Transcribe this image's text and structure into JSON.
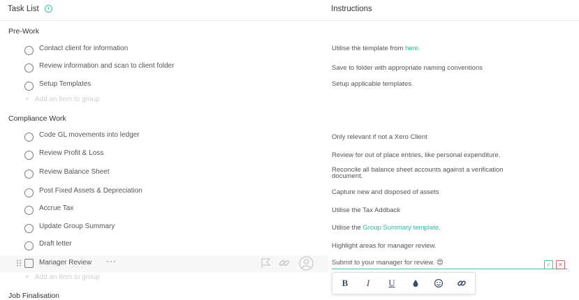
{
  "header": {
    "task_list_label": "Task List",
    "add_icon": "plus-circle-icon",
    "instructions_label": "Instructions"
  },
  "sections": [
    {
      "title": "Pre-Work"
    },
    {
      "title": "Compliance Work"
    },
    {
      "title": "Job Finalisation"
    }
  ],
  "prework": [
    {
      "label": "Contact client for information",
      "instr_before": "Utilise the template from ",
      "instr_link": "here.",
      "instr_after": ""
    },
    {
      "label": "Review information and scan to client folder",
      "instr_before": "Save to folder with appropriate naming conventions",
      "instr_link": "",
      "instr_after": ""
    },
    {
      "label": "Setup Templates",
      "instr_before": "Setup applicable templates",
      "instr_link": "",
      "instr_after": ""
    }
  ],
  "compliance": [
    {
      "label": "Code GL movements into ledger",
      "instr_before": "Only relevant if not a Xero Client",
      "instr_link": "",
      "instr_after": ""
    },
    {
      "label": "Review Profit & Loss",
      "instr_before": "Review for out of place entries, like personal expenditure.",
      "instr_link": "",
      "instr_after": ""
    },
    {
      "label": "Review Balance Sheet",
      "instr_before": "Reconcile all balance sheet accounts against a verification document.",
      "instr_link": "",
      "instr_after": ""
    },
    {
      "label": "Post Fixed Assets & Depreciation",
      "instr_before": "Capture new and disposed of assets",
      "instr_link": "",
      "instr_after": ""
    },
    {
      "label": "Accrue Tax",
      "instr_before": "Utilise the Tax Addback",
      "instr_link": "",
      "instr_after": ""
    },
    {
      "label": "Update Group Summary",
      "instr_before": "Utilise the ",
      "instr_link": "Group Summary template.",
      "instr_after": ""
    },
    {
      "label": "Draft letter",
      "instr_before": "Highlight areas for manager review.",
      "instr_link": "",
      "instr_after": ""
    },
    {
      "label": "Manager Review",
      "instr_before": "Submit to your manager for review.",
      "instr_link": "",
      "instr_after": ""
    }
  ],
  "active_row": {
    "more_label": "···",
    "emoji": "😍",
    "flag_icon": "flag-icon",
    "link_icon": "link-icon",
    "user_icon": "user-icon",
    "confirm_icon": "save-icon",
    "cancel_icon": "close-icon"
  },
  "add_item_label": "Add an item to group",
  "toolbar": {
    "bold": "B",
    "italic": "I",
    "underline": "U",
    "color_icon": "drop-icon",
    "emoji_icon": "smiley-icon",
    "link_icon": "link-icon"
  },
  "colors": {
    "accent": "#1fbf9d",
    "danger": "#e25b5b",
    "text": "#555555"
  }
}
